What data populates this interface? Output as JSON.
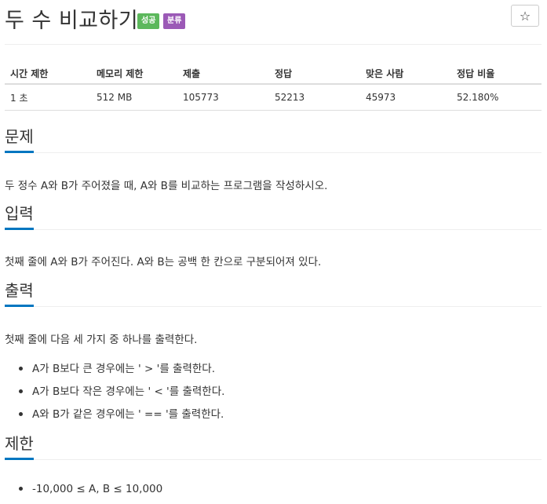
{
  "header": {
    "title": "두 수 비교하기",
    "badges": [
      "성공",
      "분류"
    ],
    "star_icon": "☆"
  },
  "info_table": {
    "headers": [
      "시간 제한",
      "메모리 제한",
      "제출",
      "정답",
      "맞은 사람",
      "정답 비율"
    ],
    "row": [
      "1 초",
      "512 MB",
      "105773",
      "52213",
      "45973",
      "52.180%"
    ]
  },
  "sections": {
    "problem": {
      "title": "문제",
      "text": "두 정수 A와 B가 주어졌을 때, A와 B를 비교하는 프로그램을 작성하시오."
    },
    "input": {
      "title": "입력",
      "text": "첫째 줄에 A와 B가 주어진다. A와 B는 공백 한 칸으로 구분되어져 있다."
    },
    "output": {
      "title": "출력",
      "text": "첫째 줄에 다음 세 가지 중 하나를 출력한다.",
      "items": [
        "A가 B보다 큰 경우에는 ' > '를 출력한다.",
        "A가 B보다 작은 경우에는 ' < '를 출력한다.",
        "A와 B가 같은 경우에는 ' == '를 출력한다."
      ]
    },
    "limit": {
      "title": "제한",
      "items": [
        "-10,000 ≤ A, B ≤ 10,000"
      ]
    }
  },
  "colors": {
    "accent": "#0076c0",
    "badge_success": "#5cb85c",
    "badge_category": "#9b59b6"
  }
}
